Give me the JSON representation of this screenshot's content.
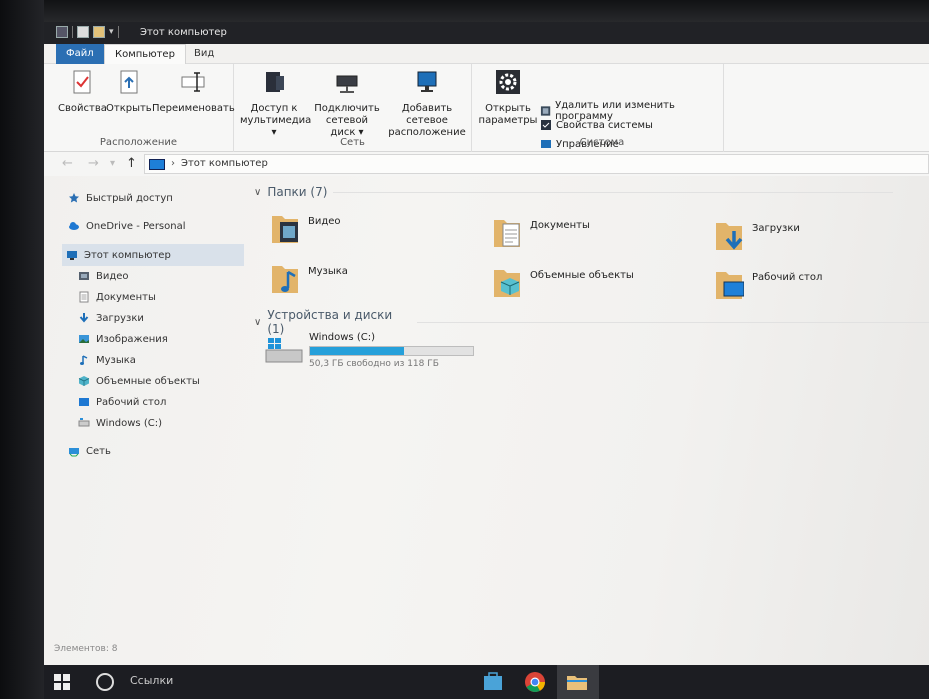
{
  "window": {
    "title": "Этот компьютер"
  },
  "ribbon_tabs": {
    "file": "Файл",
    "computer": "Компьютер",
    "view": "Вид"
  },
  "ribbon": {
    "location": {
      "label": "Расположение",
      "properties": "Свойства",
      "open": "Открыть",
      "rename": "Переименовать"
    },
    "network": {
      "label": "Сеть",
      "media_access_1": "Доступ к",
      "media_access_2": "мультимедиа ▾",
      "map_drive_1": "Подключить",
      "map_drive_2": "сетевой диск ▾",
      "add_location_1": "Добавить сетевое",
      "add_location_2": "расположение"
    },
    "system": {
      "label": "Система",
      "open_settings_1": "Открыть",
      "open_settings_2": "параметры",
      "uninstall": "Удалить или изменить программу",
      "system_props": "Свойства системы",
      "manage": "Управление"
    }
  },
  "address": {
    "path": "Этот компьютер"
  },
  "nav_pane": {
    "quick_access": "Быстрый доступ",
    "onedrive": "OneDrive - Personal",
    "this_pc": "Этот компьютер",
    "video": "Видео",
    "documents": "Документы",
    "downloads": "Загрузки",
    "images": "Изображения",
    "music": "Музыка",
    "objects3d": "Объемные объекты",
    "desktop": "Рабочий стол",
    "windows_c": "Windows (C:)",
    "network": "Сеть"
  },
  "content": {
    "folders_header": "Папки (7)",
    "folders": {
      "video": "Видео",
      "documents": "Документы",
      "downloads": "Загрузки",
      "music": "Музыка",
      "objects3d": "Объемные объекты",
      "desktop": "Рабочий стол"
    },
    "devices_header": "Устройства и диски (1)",
    "drive": {
      "name": "Windows (C:)",
      "free_text": "50,3 ГБ свободно из 118 ГБ",
      "used_fraction": 0.574
    }
  },
  "status_bar": {
    "items": "Элементов: 8"
  },
  "taskbar": {
    "search_text": "Ссылки"
  },
  "colors": {
    "accent": "#2b6fb3",
    "drive_bar": "#26a0da",
    "folder": "#e8c07a"
  }
}
